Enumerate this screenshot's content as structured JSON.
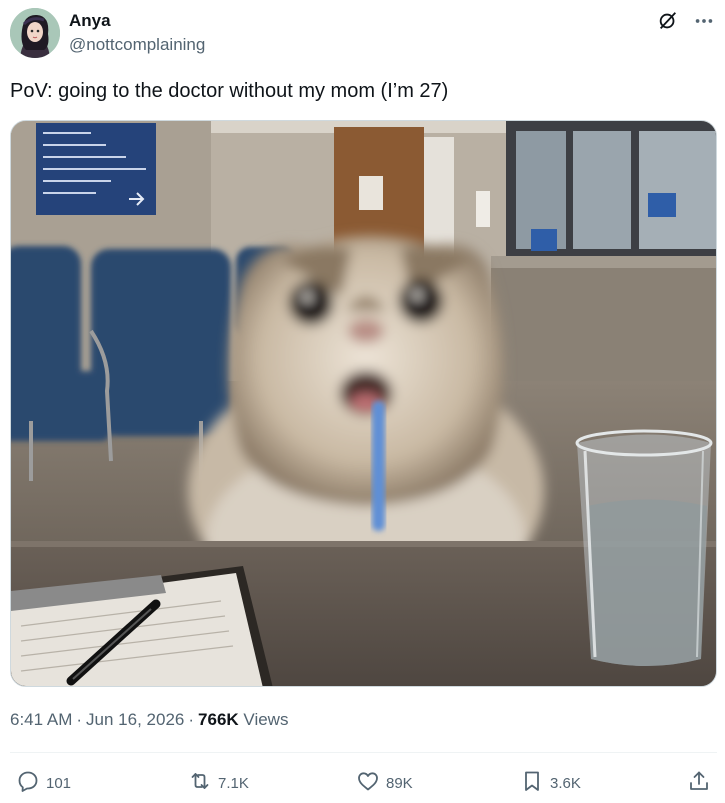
{
  "author": {
    "display_name": "Anya",
    "handle": "@nottcomplaining"
  },
  "tweet": {
    "text": "PoV: going to the doctor without my mom (I’m 27)"
  },
  "meta": {
    "time": "6:41 AM",
    "separator": "·",
    "date": "Jun 16, 2026",
    "views_count": "766K",
    "views_label": "Views"
  },
  "actions": {
    "replies": "101",
    "reposts": "7.1K",
    "likes": "89K",
    "bookmarks": "3.6K"
  },
  "icons": {
    "grok": "grok-icon",
    "more": "more-icon",
    "reply": "reply-icon",
    "repost": "repost-icon",
    "like": "heart-icon",
    "bookmark": "bookmark-icon",
    "share": "share-icon"
  },
  "colors": {
    "text_primary": "#0f1419",
    "text_secondary": "#536471",
    "border": "#cfd9de",
    "divider": "#eff3f4"
  }
}
